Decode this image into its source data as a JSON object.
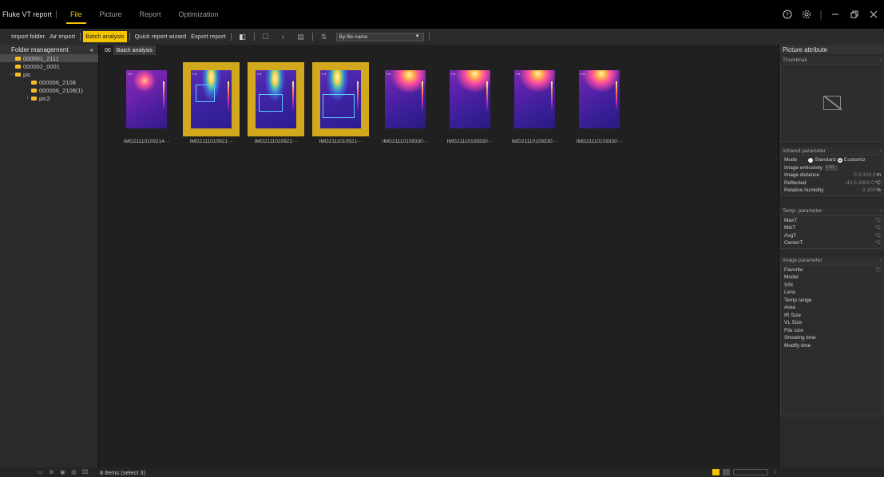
{
  "titlebar": {
    "app_title": "Fluke VT report",
    "tabs": [
      {
        "label": "File",
        "active": true
      },
      {
        "label": "Picture",
        "active": false
      },
      {
        "label": "Report",
        "active": false
      },
      {
        "label": "Optimization",
        "active": false
      }
    ],
    "controls": [
      "help-icon",
      "settings-icon",
      "minimize-icon",
      "restore-icon",
      "close-icon"
    ]
  },
  "toolbar": {
    "import_folder": "Import folder",
    "air_import": "Air import",
    "batch_analysis": "Batch analysis",
    "quick_report_wizard": "Quick report wizard",
    "export_report": "Export report",
    "sort_value": "By file name",
    "accent": "#f5c400"
  },
  "left_panel": {
    "title": "Folder management",
    "collapse_icon": "double-arrow-left-icon",
    "tree": [
      {
        "label": "000001_2111",
        "level": 0,
        "selected": true
      },
      {
        "label": "000002_0001",
        "level": 0,
        "selected": false
      },
      {
        "label": "pic",
        "level": 0,
        "expanded": true,
        "selected": false
      },
      {
        "label": "000006_2108",
        "level": 1,
        "selected": false
      },
      {
        "label": "000006_2108(1)",
        "level": 1,
        "selected": false
      },
      {
        "label": "pic2",
        "level": 1,
        "collapsed": true,
        "selected": false
      }
    ]
  },
  "center": {
    "tab_index": "00",
    "tab_label": "Batch analysis",
    "thumbnails": [
      {
        "label": "IMG21110109214···",
        "selected": false
      },
      {
        "label": "IMG2111010921···",
        "selected": true
      },
      {
        "label": "IMG2111010921···",
        "selected": true
      },
      {
        "label": "IMG2111010921···",
        "selected": true
      },
      {
        "label": "IMG21110109330···",
        "selected": false
      },
      {
        "label": "IMG21110109330···",
        "selected": false
      },
      {
        "label": "IMG21110109330···",
        "selected": false
      },
      {
        "label": "IMG21110109330···",
        "selected": false
      }
    ]
  },
  "right_panel": {
    "title": "Picture attribute",
    "thumbnail_title": "Thumbnail",
    "infrared": {
      "title": "Infrared parameter",
      "mode_label": "Mode",
      "mode_standard": "Standard",
      "mode_custom": "Customiz",
      "emissivity_label": "Image emissivity",
      "emissivity_value": "0.98",
      "distance_label": "Image distance",
      "distance_range": "0.0-100.0",
      "distance_unit": "m",
      "reflected_label": "Reflected",
      "reflected_range": "-40.0-2000.0",
      "reflected_unit": "°C",
      "humidity_label": "Relative humidity",
      "humidity_range": "0-100",
      "humidity_unit": "%"
    },
    "temp": {
      "title": "Temp. parameter",
      "rows": [
        {
          "label": "MaxT",
          "unit": "°C"
        },
        {
          "label": "MinT",
          "unit": "°C"
        },
        {
          "label": "AvgT",
          "unit": "°C"
        },
        {
          "label": "CenterT",
          "unit": "°C"
        }
      ]
    },
    "image": {
      "title": "Image parameter",
      "rows": [
        "Favorite",
        "Model",
        "S/N",
        "Lens",
        "Temp range",
        "Area",
        "IR Size",
        "VL Size",
        "File size",
        "Shooting time",
        "Modify time"
      ]
    }
  },
  "statusbar": {
    "text": "8 items (select 3)"
  }
}
